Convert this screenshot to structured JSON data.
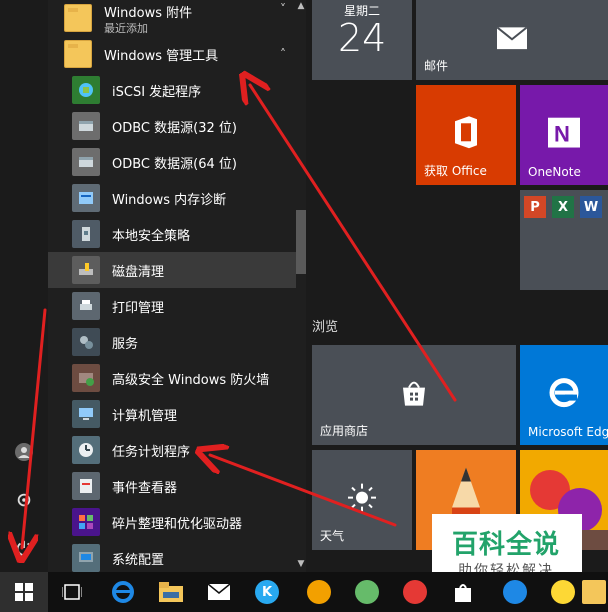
{
  "rail": {
    "user_icon": "user-icon",
    "settings_icon": "gear-icon",
    "power_icon": "power-icon"
  },
  "applist": {
    "groups": [
      {
        "label": "Windows 附件",
        "sub": "最近添加",
        "chevron": "˅"
      },
      {
        "label": "Windows 管理工具",
        "chevron": "˄"
      }
    ],
    "items": [
      {
        "label": "iSCSI 发起程序"
      },
      {
        "label": "ODBC 数据源(32 位)"
      },
      {
        "label": "ODBC 数据源(64 位)"
      },
      {
        "label": "Windows 内存诊断"
      },
      {
        "label": "本地安全策略"
      },
      {
        "label": "磁盘清理"
      },
      {
        "label": "打印管理"
      },
      {
        "label": "服务"
      },
      {
        "label": "高级安全 Windows 防火墙"
      },
      {
        "label": "计算机管理"
      },
      {
        "label": "任务计划程序"
      },
      {
        "label": "事件查看器"
      },
      {
        "label": "碎片整理和优化驱动器"
      },
      {
        "label": "系统配置"
      }
    ]
  },
  "tiles": {
    "calendar": {
      "day": "星期二",
      "date": "24"
    },
    "mail": {
      "label": "邮件"
    },
    "office": {
      "label": "获取 Office"
    },
    "onenote": {
      "label": "OneNote"
    },
    "section_label": "浏览",
    "store": {
      "label": "应用商店"
    },
    "edge": {
      "label": "Microsoft Edge"
    },
    "weather": {
      "label": "天气"
    },
    "mini": {
      "ppt": "P",
      "excel": "X",
      "word": "W"
    }
  },
  "watermark": {
    "title": "百科全说",
    "subtitle": "助你轻松解决"
  },
  "colors": {
    "accent": "#3a6ea5",
    "tile_gray": "#4a4f56",
    "office": "#d83b01",
    "onenote": "#7719aa",
    "edge": "#0078d7",
    "arrow": "#e02020"
  }
}
